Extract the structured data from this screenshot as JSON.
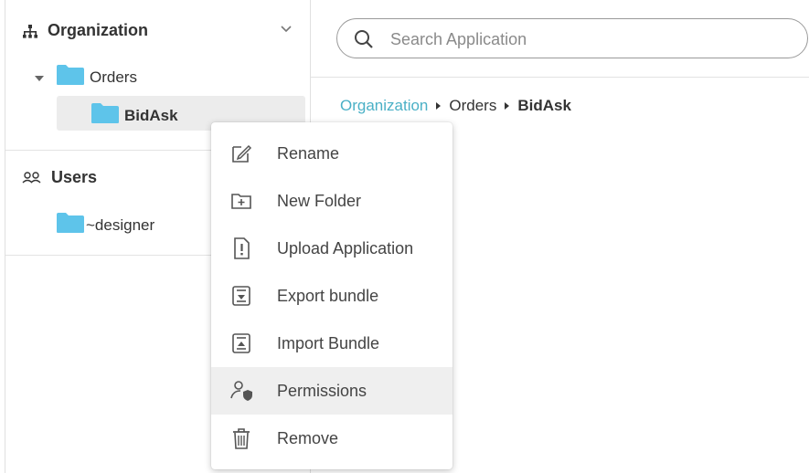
{
  "tree": {
    "organization": {
      "title": "Organization",
      "children": [
        {
          "label": "Orders",
          "children": [
            {
              "label": "BidAsk"
            }
          ]
        }
      ]
    },
    "users": {
      "title": "Users",
      "children": [
        {
          "label": "~designer"
        }
      ]
    }
  },
  "search": {
    "placeholder": "Search Application"
  },
  "breadcrumb": [
    "Organization",
    "Orders",
    "BidAsk"
  ],
  "context_menu": {
    "items": [
      {
        "label": "Rename",
        "icon": "rename-icon"
      },
      {
        "label": "New Folder",
        "icon": "new-folder-icon"
      },
      {
        "label": "Upload Application",
        "icon": "upload-application-icon"
      },
      {
        "label": "Export bundle",
        "icon": "export-bundle-icon"
      },
      {
        "label": "Import Bundle",
        "icon": "import-bundle-icon"
      },
      {
        "label": "Permissions",
        "icon": "permissions-icon",
        "highlighted": true
      },
      {
        "label": "Remove",
        "icon": "trash-icon"
      }
    ]
  },
  "colors": {
    "accent_link": "#4ab0c6",
    "folder": "#5ec4ea",
    "selected_bg": "#ececec",
    "hover_bg": "#efefef"
  }
}
